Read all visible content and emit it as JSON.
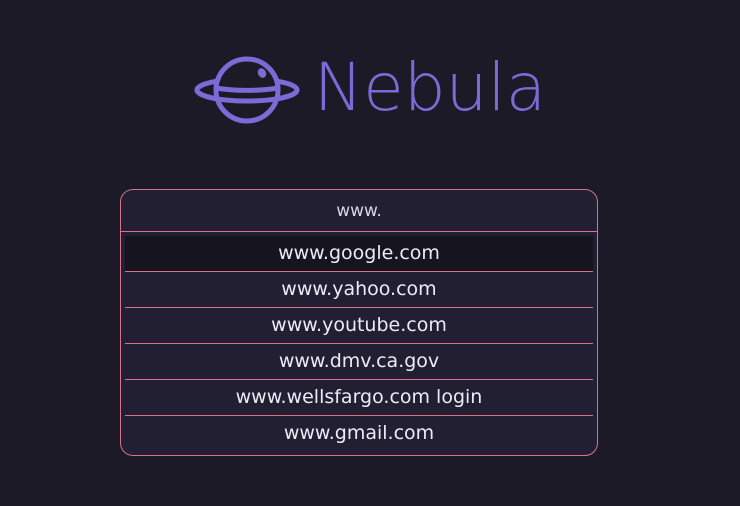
{
  "brand": {
    "name": "Nebula",
    "accent_color": "#7c6bd6",
    "icon": "planet-icon"
  },
  "search": {
    "value": "www.",
    "border_color": "#d9708e"
  },
  "suggestions": [
    "www.google.com",
    "www.yahoo.com",
    "www.youtube.com",
    "www.dmv.ca.gov",
    "www.wellsfargo.com login",
    "www.gmail.com"
  ]
}
